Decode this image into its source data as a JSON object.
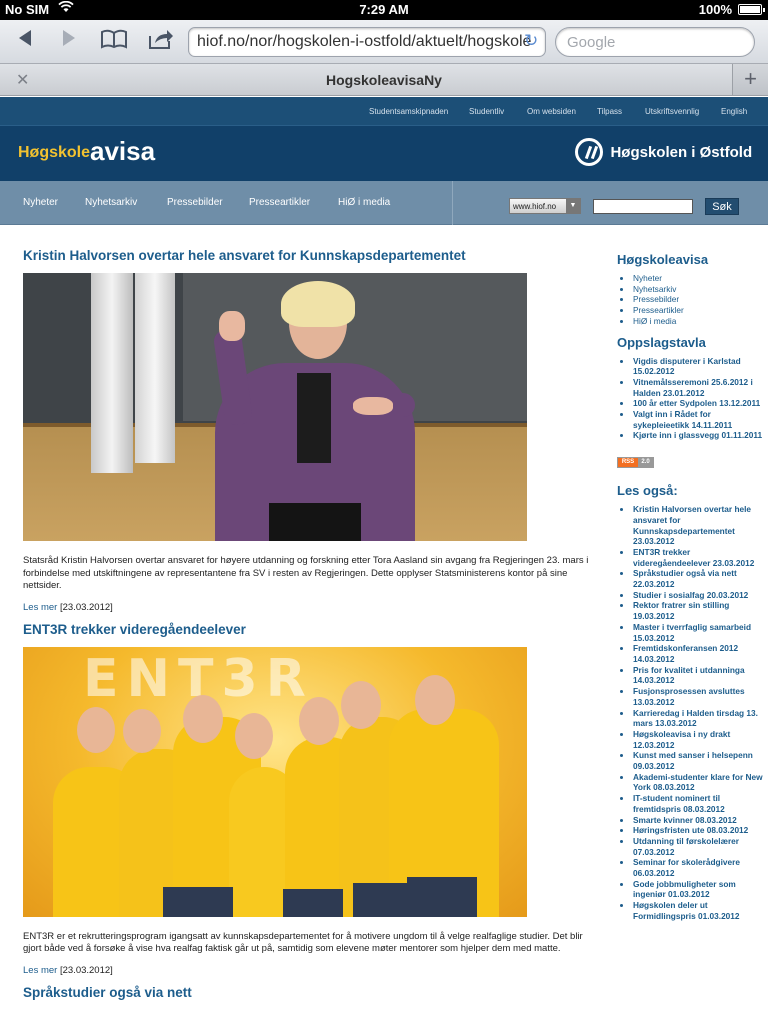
{
  "status_bar": {
    "carrier": "No SIM",
    "time": "7:29 AM",
    "battery": "100%"
  },
  "browser": {
    "url": "hiof.no/nor/hogskolen-i-ostfold/aktuelt/hogskole",
    "search_placeholder": "Google",
    "tab_title": "HogskoleavisaNy"
  },
  "topnav": [
    "Studentsamskipnaden",
    "Studentliv",
    "Om websiden",
    "Tilpass",
    "Utskriftsvennlig",
    "English"
  ],
  "logo": {
    "prefix": "Høgskole",
    "main": "avisa",
    "institution": "Høgskolen i Østfold"
  },
  "mainnav": [
    "Nyheter",
    "Nyhetsarkiv",
    "Pressebilder",
    "Presseartikler",
    "HiØ i media"
  ],
  "site_select": "www.hiof.no",
  "search_button": "Søk",
  "articles": [
    {
      "title": "Kristin Halvorsen overtar hele ansvaret for Kunnskapsdepartementet",
      "text": "Statsråd Kristin Halvorsen overtar ansvaret for høyere utdanning og forskning etter Tora Aasland sin avgang fra Regjeringen 23. mars i forbindelse med utskiftningene av representantene fra SV i resten av Regjeringen. Dette opplyser Statsministerens kontor på sine nettsider.",
      "more": "Les mer",
      "date": "[23.03.2012]"
    },
    {
      "title": "ENT3R trekker videregåendeelever",
      "image_text": "ENT3R",
      "text": "ENT3R er et rekrutteringsprogram igangsatt av kunnskapsdepartementet for å motivere ungdom til å velge realfaglige studier. Det blir gjort både ved å forsøke å vise hva realfag faktisk går ut på, samtidig som elevene møter mentorer som hjelper dem med matte.",
      "more": "Les mer",
      "date": "[23.03.2012]"
    },
    {
      "title": "Språkstudier også via nett"
    }
  ],
  "sidebar": {
    "heading1": "Høgskoleavisa",
    "links": [
      "Nyheter",
      "Nyhetsarkiv",
      "Pressebilder",
      "Presseartikler",
      "HiØ i media"
    ],
    "heading2": "Oppslagstavla",
    "board": [
      "Vigdis disputerer i Karlstad 15.02.2012",
      "Vitnemålsseremoni 25.6.2012 i Halden 23.01.2012",
      "100 år etter Sydpolen 13.12.2011",
      "Valgt inn i Rådet for sykepleieetikk 14.11.2011",
      "Kjørte inn i glassvegg 01.11.2011"
    ],
    "rss_left": "RSS",
    "rss_right": "2.0",
    "heading3": "Les også:",
    "also": [
      "Kristin Halvorsen overtar hele ansvaret for Kunnskapsdepartementet 23.03.2012",
      "ENT3R trekker videregåendeelever 23.03.2012",
      "Språkstudier også via nett 22.03.2012",
      "Studier i sosialfag 20.03.2012",
      "Rektor fratrer sin stilling 19.03.2012",
      "Master i tverrfaglig samarbeid 15.03.2012",
      "Fremtidskonferansen 2012 14.03.2012",
      "Pris for kvalitet i utdanninga 14.03.2012",
      "Fusjonsprosessen avsluttes 13.03.2012",
      "Karrieredag i Halden tirsdag 13. mars 13.03.2012",
      "Høgskoleavisa i ny drakt 12.03.2012",
      "Kunst med sanser i helsepenn 09.03.2012",
      "Akademi-studenter klare for New York 08.03.2012",
      "IT-student nominert til fremtidspris 08.03.2012",
      "Smarte kvinner 08.03.2012",
      "Høringsfristen ute 08.03.2012",
      "Utdanning til førskolelærer 07.03.2012",
      "Seminar for skolerådgivere 06.03.2012",
      "Gode jobbmuligheter som ingeniør 01.03.2012",
      "Høgskolen deler ut Formidlingspris 01.03.2012"
    ]
  }
}
